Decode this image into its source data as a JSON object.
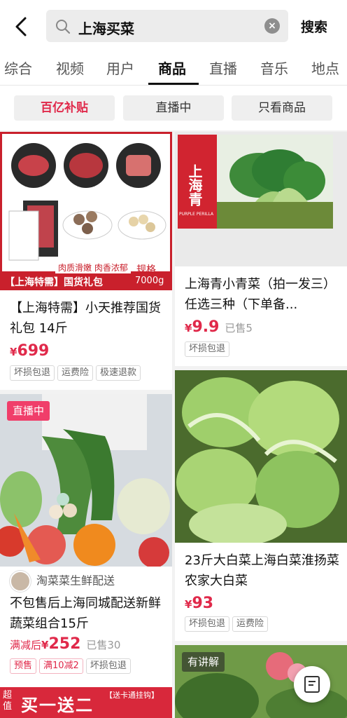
{
  "search": {
    "query": "上海买菜",
    "button_label": "搜索"
  },
  "tabs": [
    {
      "label": "综合"
    },
    {
      "label": "视频"
    },
    {
      "label": "用户"
    },
    {
      "label": "商品"
    },
    {
      "label": "直播"
    },
    {
      "label": "音乐"
    },
    {
      "label": "地点"
    }
  ],
  "active_tab": "商品",
  "filters": [
    {
      "label": "百亿补贴"
    },
    {
      "label": "直播中"
    },
    {
      "label": "只看商品"
    }
  ],
  "products": [
    {
      "image_overlay_1": "肉质滑嫩 肉香浓郁",
      "image_overlay_2": "规格",
      "image_overlay_3": "7000g",
      "image_overlay_4": "【上海特需】国货礼包",
      "title": "【上海特需】小天推荐国货礼包 14斤",
      "price_symbol": "¥",
      "price": "699",
      "tags": [
        "坏损包退",
        "运费险",
        "极速退款"
      ]
    },
    {
      "image_overlay_1": "上海青",
      "image_overlay_2": "PURPLE PERILLA",
      "title": "上海青小青菜（拍一发三）任选三种（下单备...",
      "price_symbol": "¥",
      "price": "9.9",
      "sold": "已售5",
      "tags": [
        "坏损包退"
      ]
    },
    {
      "badge": "直播中",
      "shop_name": "淘菜菜生鲜配送",
      "title": "不包售后上海同城配送新鲜蔬菜组合15斤",
      "price_prefix": "满减后",
      "price_symbol": "¥",
      "price": "252",
      "sold": "已售30",
      "tags": [
        "预售",
        "满10减2",
        "坏损包退"
      ]
    },
    {
      "title": "23斤大白菜上海白菜淮扬菜农家大白菜",
      "price_symbol": "¥",
      "price": "93",
      "tags": [
        "坏损包退",
        "运费险"
      ]
    },
    {
      "badge": "有讲解"
    }
  ],
  "promo": {
    "left": "超值",
    "main": "买一送二",
    "right": "【送卡通挂钩】"
  },
  "colors": {
    "accent": "#e0294a",
    "live": "#f03e6a"
  }
}
